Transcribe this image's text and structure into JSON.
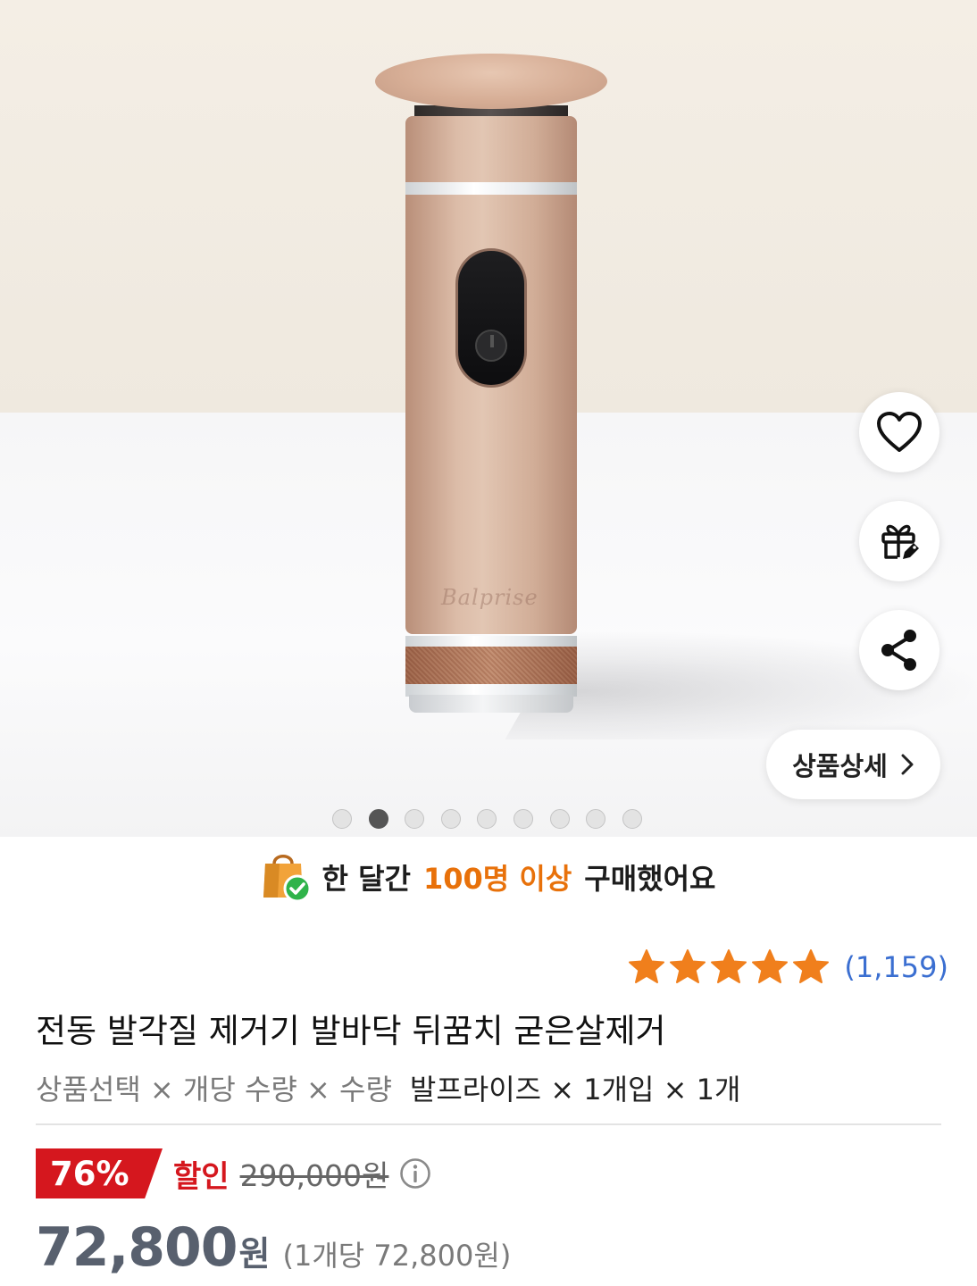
{
  "gallery": {
    "brand_mark": "Balprise",
    "active_index": 1,
    "dots": [
      0,
      1,
      2,
      3,
      4,
      5,
      6,
      7,
      8
    ],
    "detail_button": "상품상세"
  },
  "actions": {
    "wishlist_icon": "heart-icon",
    "gift_icon": "gift-icon",
    "share_icon": "share-icon"
  },
  "banner": {
    "prefix": "한 달간",
    "highlight": "100명 이상",
    "suffix": "구매했어요",
    "highlight_color": "#e8710a"
  },
  "rating": {
    "stars": 5,
    "count": "(1,159)",
    "star_color": "#f07f1c"
  },
  "product": {
    "title": "전동 발각질 제거기 발바닥 뒤꿈치 굳은살제거",
    "options_label": "상품선택 × 개당 수량 × 수량",
    "options_value": "발프라이즈 × 1개입 × 1개"
  },
  "pricing": {
    "discount_badge": "76%",
    "discount_label": "할인",
    "original_price": "290,000원",
    "price": "72,800",
    "currency": "원",
    "unit_price": "(1개당 72,800원)",
    "badge_color": "#d5171e"
  }
}
